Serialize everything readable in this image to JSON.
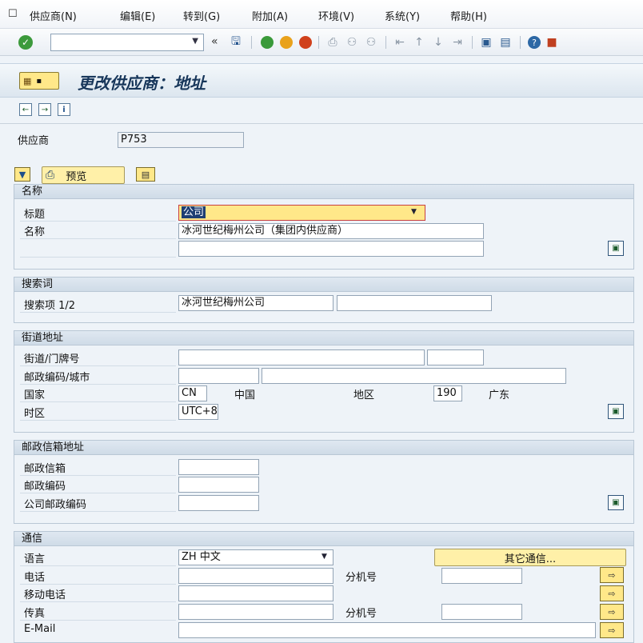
{
  "menu": {
    "icon": "menu-exit-icon",
    "items": [
      "供应商(N)",
      "编辑(E)",
      "转到(G)",
      "附加(A)",
      "环境(V)",
      "系统(Y)",
      "帮助(H)"
    ]
  },
  "toolbar": {
    "command_value": "",
    "collapse_glyph": "«"
  },
  "title": {
    "text": "更改供应商：地址",
    "menu_button_glyph": "▪"
  },
  "header": {
    "vendor_label": "供应商",
    "vendor_value": "P753"
  },
  "actions": {
    "preview_label": "预览"
  },
  "name_group": {
    "heading": "名称",
    "title_label": "标题",
    "title_value": "公司",
    "name_label": "名称",
    "name_value": "冰河世纪梅州公司（集团内供应商）",
    "name2_value": ""
  },
  "search_group": {
    "heading": "搜索词",
    "search_label": "搜索项 1/2",
    "search1_value": "冰河世纪梅州公司",
    "search2_value": ""
  },
  "street_group": {
    "heading": "街道地址",
    "street_label": "街道/门牌号",
    "postal_city_label": "邮政编码/城市",
    "country_label": "国家",
    "country_code": "CN",
    "country_name": "中国",
    "region_label": "地区",
    "region_code": "190",
    "region_name": "广东",
    "timezone_label": "时区",
    "timezone_value": "UTC+8"
  },
  "pobox_group": {
    "heading": "邮政信箱地址",
    "pobox_label": "邮政信箱",
    "postal_label": "邮政编码",
    "company_postal_label": "公司邮政编码"
  },
  "comm_group": {
    "heading": "通信",
    "language_label": "语言",
    "language_value": "ZH 中文",
    "other_comm_label": "其它通信...",
    "phone_label": "电话",
    "ext_label": "分机号",
    "mobile_label": "移动电话",
    "fax_label": "传真",
    "fax_ext_label": "分机号",
    "email_label": "E-Mail"
  },
  "colors": {
    "accent_yellow": "#ffe889",
    "title_color": "#17365a"
  }
}
